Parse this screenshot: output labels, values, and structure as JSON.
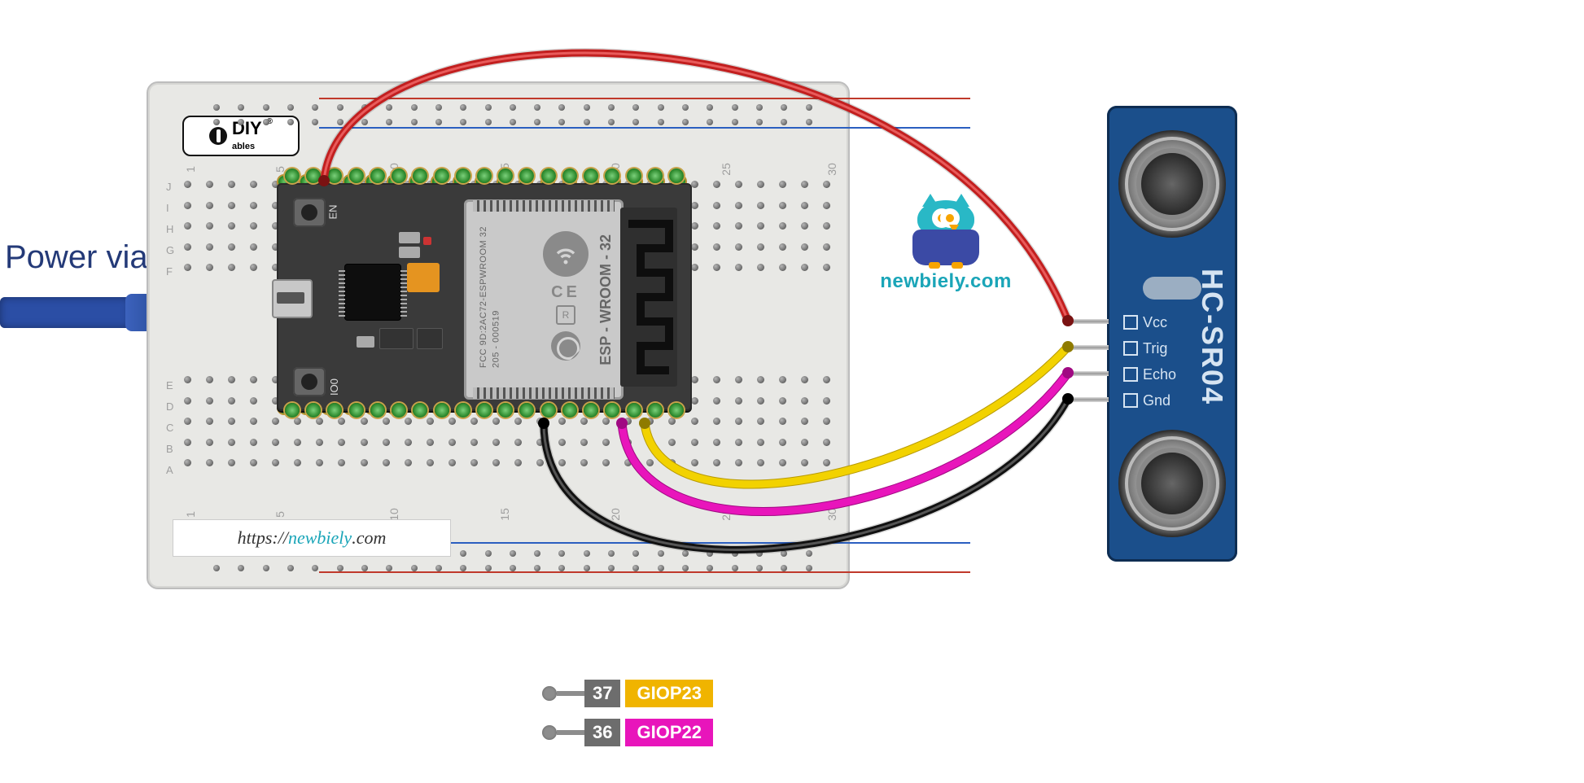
{
  "labels": {
    "power": "Power via USB",
    "url_prefix": "https://",
    "url_brand": "newbiely",
    "url_suffix": ".com",
    "logo_brand": "newbiely.com",
    "bb_brand_main": "DIY",
    "bb_brand_sub": "ables"
  },
  "esp32": {
    "btn_en": "EN",
    "btn_io0": "IO0",
    "shield_line1": "FCC 9D:2AC72-ESPWROOM 32",
    "shield_line2": "205 - 000519",
    "shield_module": "ESP - WROOM - 32",
    "chip_mark": "●"
  },
  "sensor": {
    "name": "HC-SR04",
    "pins": [
      "Vcc",
      "Trig",
      "Echo",
      "Gnd"
    ]
  },
  "legend": [
    {
      "num": "37",
      "name": "GIOP23",
      "color": "yellow"
    },
    {
      "num": "36",
      "name": "GIOP22",
      "color": "magenta"
    }
  ],
  "breadboard": {
    "cols": [
      "1",
      "5",
      "10",
      "15",
      "20",
      "25",
      "30"
    ],
    "rows_top": [
      "J",
      "I",
      "H",
      "G",
      "F"
    ],
    "rows_bot": [
      "E",
      "D",
      "C",
      "B",
      "A"
    ]
  },
  "wires": [
    {
      "color": "red",
      "from": "ESP32 VIN (breadboard F3)",
      "to": "HC-SR04 Vcc"
    },
    {
      "color": "yellow",
      "from": "ESP32 GPIO23 (pin 37)",
      "to": "HC-SR04 Trig"
    },
    {
      "color": "magenta",
      "from": "ESP32 GPIO22 (pin 36)",
      "to": "HC-SR04 Echo"
    },
    {
      "color": "black",
      "from": "ESP32 GND",
      "to": "HC-SR04 Gnd"
    }
  ]
}
